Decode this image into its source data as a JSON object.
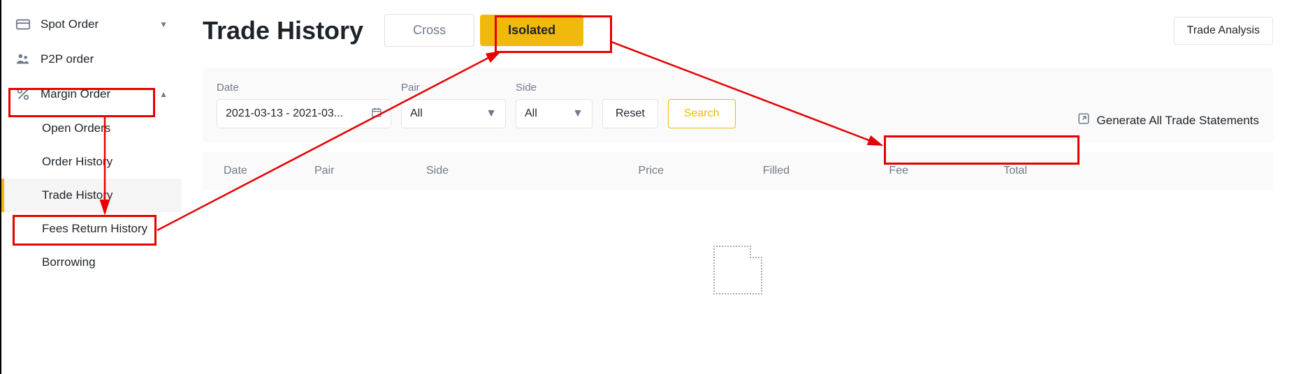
{
  "sidebar": {
    "spot_order": "Spot Order",
    "p2p_order": "P2P order",
    "margin_order": "Margin Order",
    "subitems": {
      "open_orders": "Open Orders",
      "order_history": "Order History",
      "trade_history": "Trade History",
      "fees_return": "Fees Return History",
      "borrowing": "Borrowing"
    }
  },
  "header": {
    "title": "Trade History",
    "tab_cross": "Cross",
    "tab_isolated": "Isolated",
    "trade_analysis": "Trade Analysis"
  },
  "filters": {
    "date_label": "Date",
    "date_value": "2021-03-13 - 2021-03...",
    "pair_label": "Pair",
    "pair_value": "All",
    "side_label": "Side",
    "side_value": "All",
    "reset": "Reset",
    "search": "Search",
    "generate": "Generate All Trade Statements"
  },
  "table": {
    "date": "Date",
    "pair": "Pair",
    "side": "Side",
    "price": "Price",
    "filled": "Filled",
    "fee": "Fee",
    "total": "Total"
  }
}
